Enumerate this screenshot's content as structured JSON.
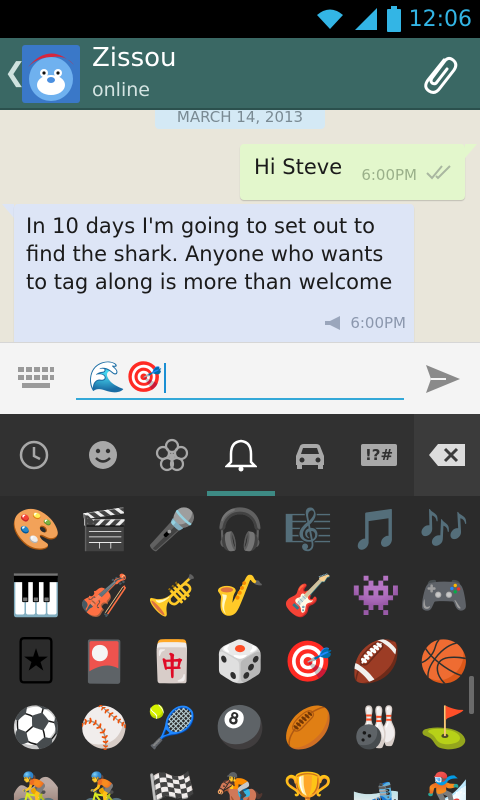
{
  "status_bar": {
    "time": "12:06"
  },
  "header": {
    "contact_name": "Zissou",
    "contact_status": "online",
    "back_icon": "chevron-left-icon",
    "attach_icon": "paperclip-icon"
  },
  "chat": {
    "date_divider": "MARCH 14, 2013",
    "messages": [
      {
        "direction": "out",
        "text": "Hi Steve",
        "time": "6:00PM",
        "status_icon": "double-check-icon"
      },
      {
        "direction": "in",
        "text": "In 10 days I'm going to set out to find the shark. Anyone who wants to tag along is more than welcome",
        "time": "6:00PM",
        "status_icon": "broadcast-icon"
      }
    ]
  },
  "composer": {
    "input_value": "🌊🎯",
    "keyboard_icon": "keyboard-icon",
    "send_icon": "send-icon"
  },
  "emoji_keyboard": {
    "tabs": [
      {
        "name": "recent",
        "icon": "clock-icon"
      },
      {
        "name": "people",
        "icon": "smiley-icon"
      },
      {
        "name": "nature",
        "icon": "flower-icon"
      },
      {
        "name": "objects",
        "icon": "bell-icon",
        "selected": true
      },
      {
        "name": "places",
        "icon": "car-icon"
      },
      {
        "name": "symbols",
        "label": "!?#"
      }
    ],
    "backspace_icon": "backspace-icon",
    "emojis": [
      "🎨",
      "🎬",
      "🎤",
      "🎧",
      "🎼",
      "🎵",
      "🎶",
      "🎹",
      "🎻",
      "🎺",
      "🎷",
      "🎸",
      "👾",
      "🎮",
      "🃏",
      "🎴",
      "🀄",
      "🎲",
      "🎯",
      "🏈",
      "🏀",
      "⚽",
      "⚾",
      "🎾",
      "🎱",
      "🏉",
      "🎳",
      "⛳",
      "🚵",
      "🚴",
      "🏁",
      "🏇",
      "🏆",
      "🎿",
      "🏂"
    ]
  },
  "colors": {
    "header_bg": "#3a6864",
    "chat_bg": "#e9e6da",
    "bubble_out": "#e3f7cc",
    "bubble_in": "#dde5f6",
    "accent": "#33a8d8",
    "keyboard_bg": "#2b2b2b"
  }
}
